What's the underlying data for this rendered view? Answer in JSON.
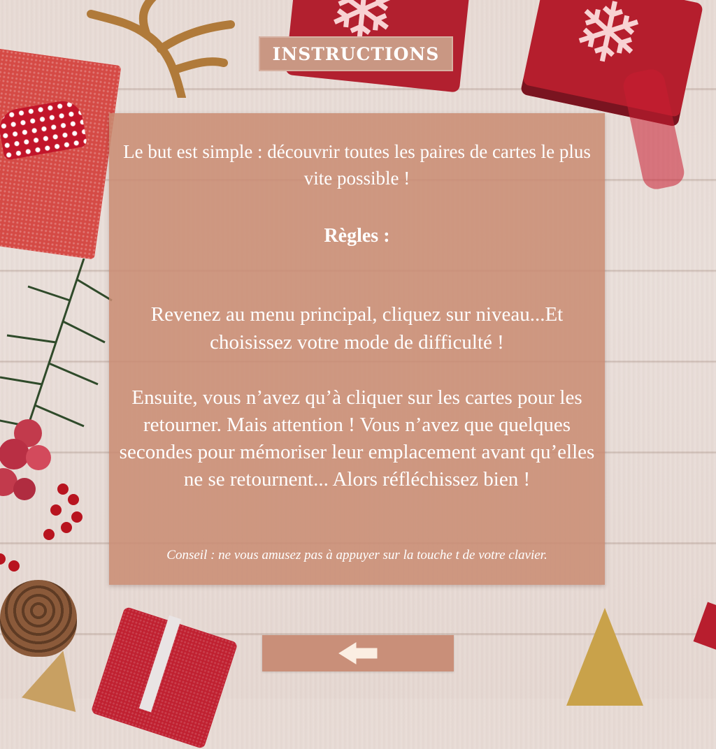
{
  "header": {
    "title": "INSTRUCTIONS"
  },
  "panel": {
    "intro": "Le but est simple : découvrir toutes les paires de cartes le plus vite possible !",
    "rules_heading": "Règles :",
    "paragraph_1": "Revenez au menu principal, cliquez sur niveau...Et choisissez votre mode de difficulté !",
    "paragraph_2": "Ensuite, vous n’avez qu’à cliquer sur les cartes pour les retourner. Mais attention ! Vous n’avez que quelques secondes pour mémoriser leur emplacement avant qu’elles ne se retournent... Alors réfléchissez bien !",
    "tip": "Conseil : ne vous amusez pas à appuyer sur la touche t de votre clavier."
  },
  "back_button": {
    "icon": "arrow-left-icon"
  },
  "colors": {
    "accent": "#c99783",
    "panel": "#c98c72",
    "text": "#ffffff"
  }
}
